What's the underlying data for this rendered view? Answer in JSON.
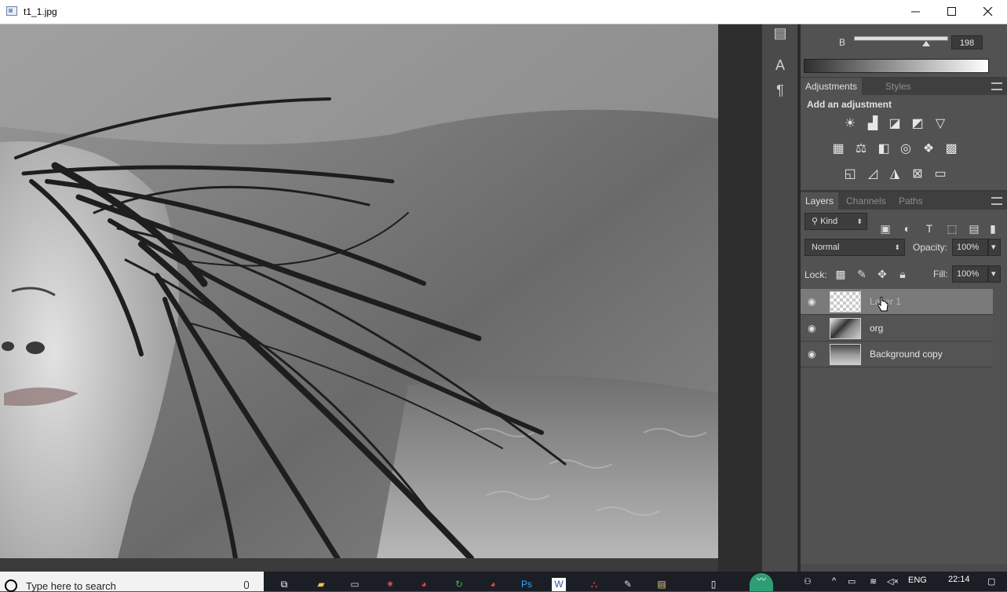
{
  "window": {
    "title": "t1_1.jpg",
    "minimize": "—",
    "maximize": "☐",
    "close": "✕"
  },
  "color_panel": {
    "channel_label": "B",
    "channel_value": "198"
  },
  "adjustments": {
    "tabs": [
      "Adjustments",
      "Styles"
    ],
    "heading": "Add an adjustment"
  },
  "layers_panel": {
    "tabs": [
      "Layers",
      "Channels",
      "Paths"
    ],
    "filter_kind": "Kind",
    "blend_mode": "Normal",
    "opacity_label": "Opacity:",
    "opacity_value": "100%",
    "lock_label": "Lock:",
    "fill_label": "Fill:",
    "fill_value": "100%",
    "layers": [
      {
        "name": "Layer 1",
        "selected": true
      },
      {
        "name": "org",
        "selected": false
      },
      {
        "name": "Background copy",
        "selected": false
      }
    ]
  },
  "taskbar": {
    "search_placeholder": "Type here to search",
    "language": "ENG",
    "time": "22:14"
  },
  "icons": {
    "text_tool": "A",
    "paragraph": "¶",
    "eye": "visibility-icon"
  }
}
